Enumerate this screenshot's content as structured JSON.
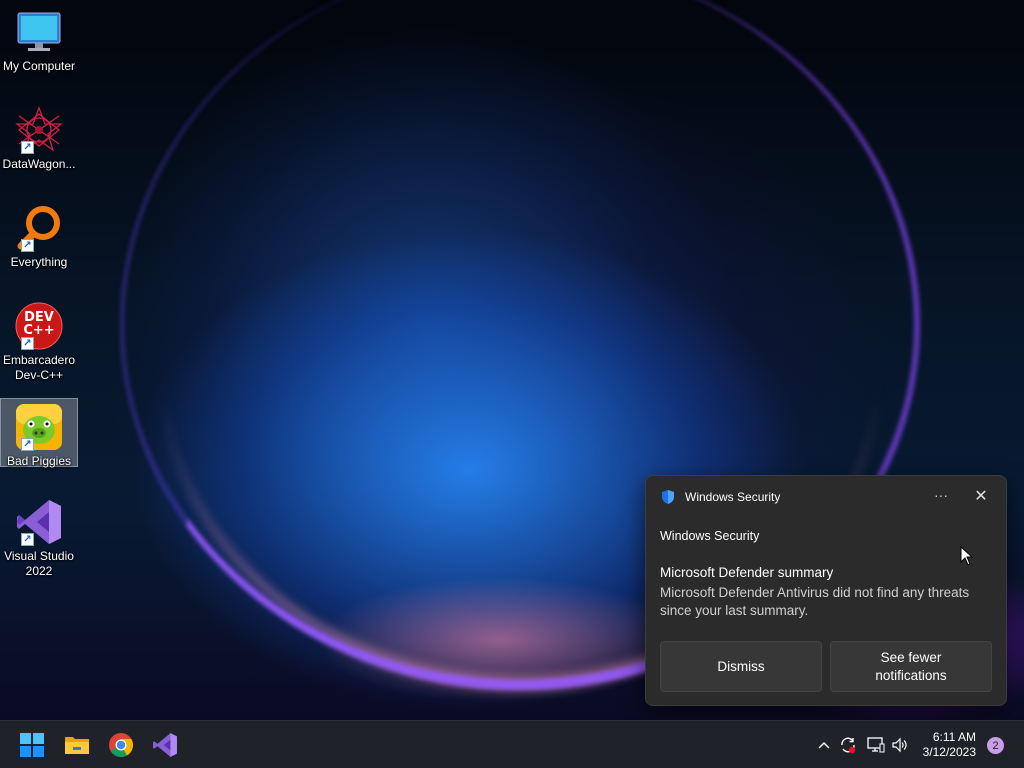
{
  "desktop": {
    "icons": [
      {
        "label": "My Computer",
        "icon": "monitor-icon"
      },
      {
        "label": "DataWagon...",
        "icon": "datawagon-icon"
      },
      {
        "label": "Everything",
        "icon": "everything-search-icon"
      },
      {
        "label": "Embarcadero Dev-C++",
        "icon": "devcpp-icon",
        "icon_text": "DEV C++"
      },
      {
        "label": "Bad Piggies",
        "icon": "bad-piggies-icon"
      },
      {
        "label": "Visual Studio 2022",
        "icon": "visual-studio-icon"
      }
    ]
  },
  "toast": {
    "app_name": "Windows Security",
    "header_app": "Windows Security",
    "title": "Microsoft Defender summary",
    "body": "Microsoft Defender Antivirus did not find any threats since your last summary.",
    "more_label": "···",
    "close_label": "✕",
    "dismiss_label": "Dismiss",
    "fewer_label": "See fewer notifications"
  },
  "taskbar": {
    "apps": [
      "start-icon",
      "file-explorer-icon",
      "chrome-icon",
      "visual-studio-icon"
    ],
    "tray": [
      "chevron-up-icon",
      "sync-icon",
      "network-icon",
      "volume-icon"
    ],
    "time": "6:11 AM",
    "date": "3/12/2023",
    "notification_count": "2"
  },
  "colors": {
    "taskbar": "#1f2228",
    "toast_bg": "#2b2b2b",
    "button_bg": "#373737",
    "badge": "#c99de8"
  }
}
